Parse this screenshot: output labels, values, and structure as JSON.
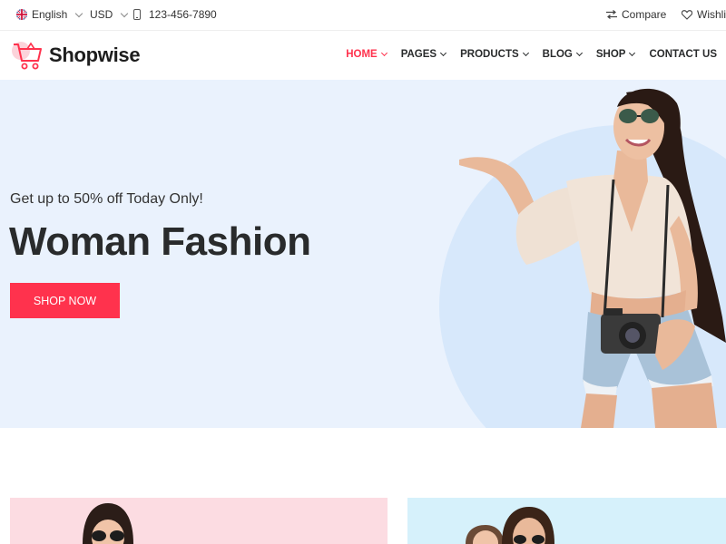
{
  "topbar": {
    "language": "English",
    "currency": "USD",
    "phone": "123-456-7890",
    "compare": "Compare",
    "wishlist": "Wishlis"
  },
  "header": {
    "brand": "Shopwise",
    "nav": [
      "HOME",
      "PAGES",
      "PRODUCTS",
      "BLOG",
      "SHOP",
      "CONTACT US"
    ]
  },
  "hero": {
    "subtitle": "Get up to 50% off Today Only!",
    "title": "Woman Fashion",
    "button": "SHOP NOW"
  },
  "colors": {
    "accent": "#ff324d",
    "hero_bg": "#eaf2fd",
    "banner_pink": "#fcdce2",
    "banner_blue": "#d6f1fb"
  },
  "icons": [
    "uk-flag-icon",
    "phone-icon",
    "compare-icon",
    "heart-icon",
    "cart-logo-icon",
    "chevron-down-icon"
  ]
}
